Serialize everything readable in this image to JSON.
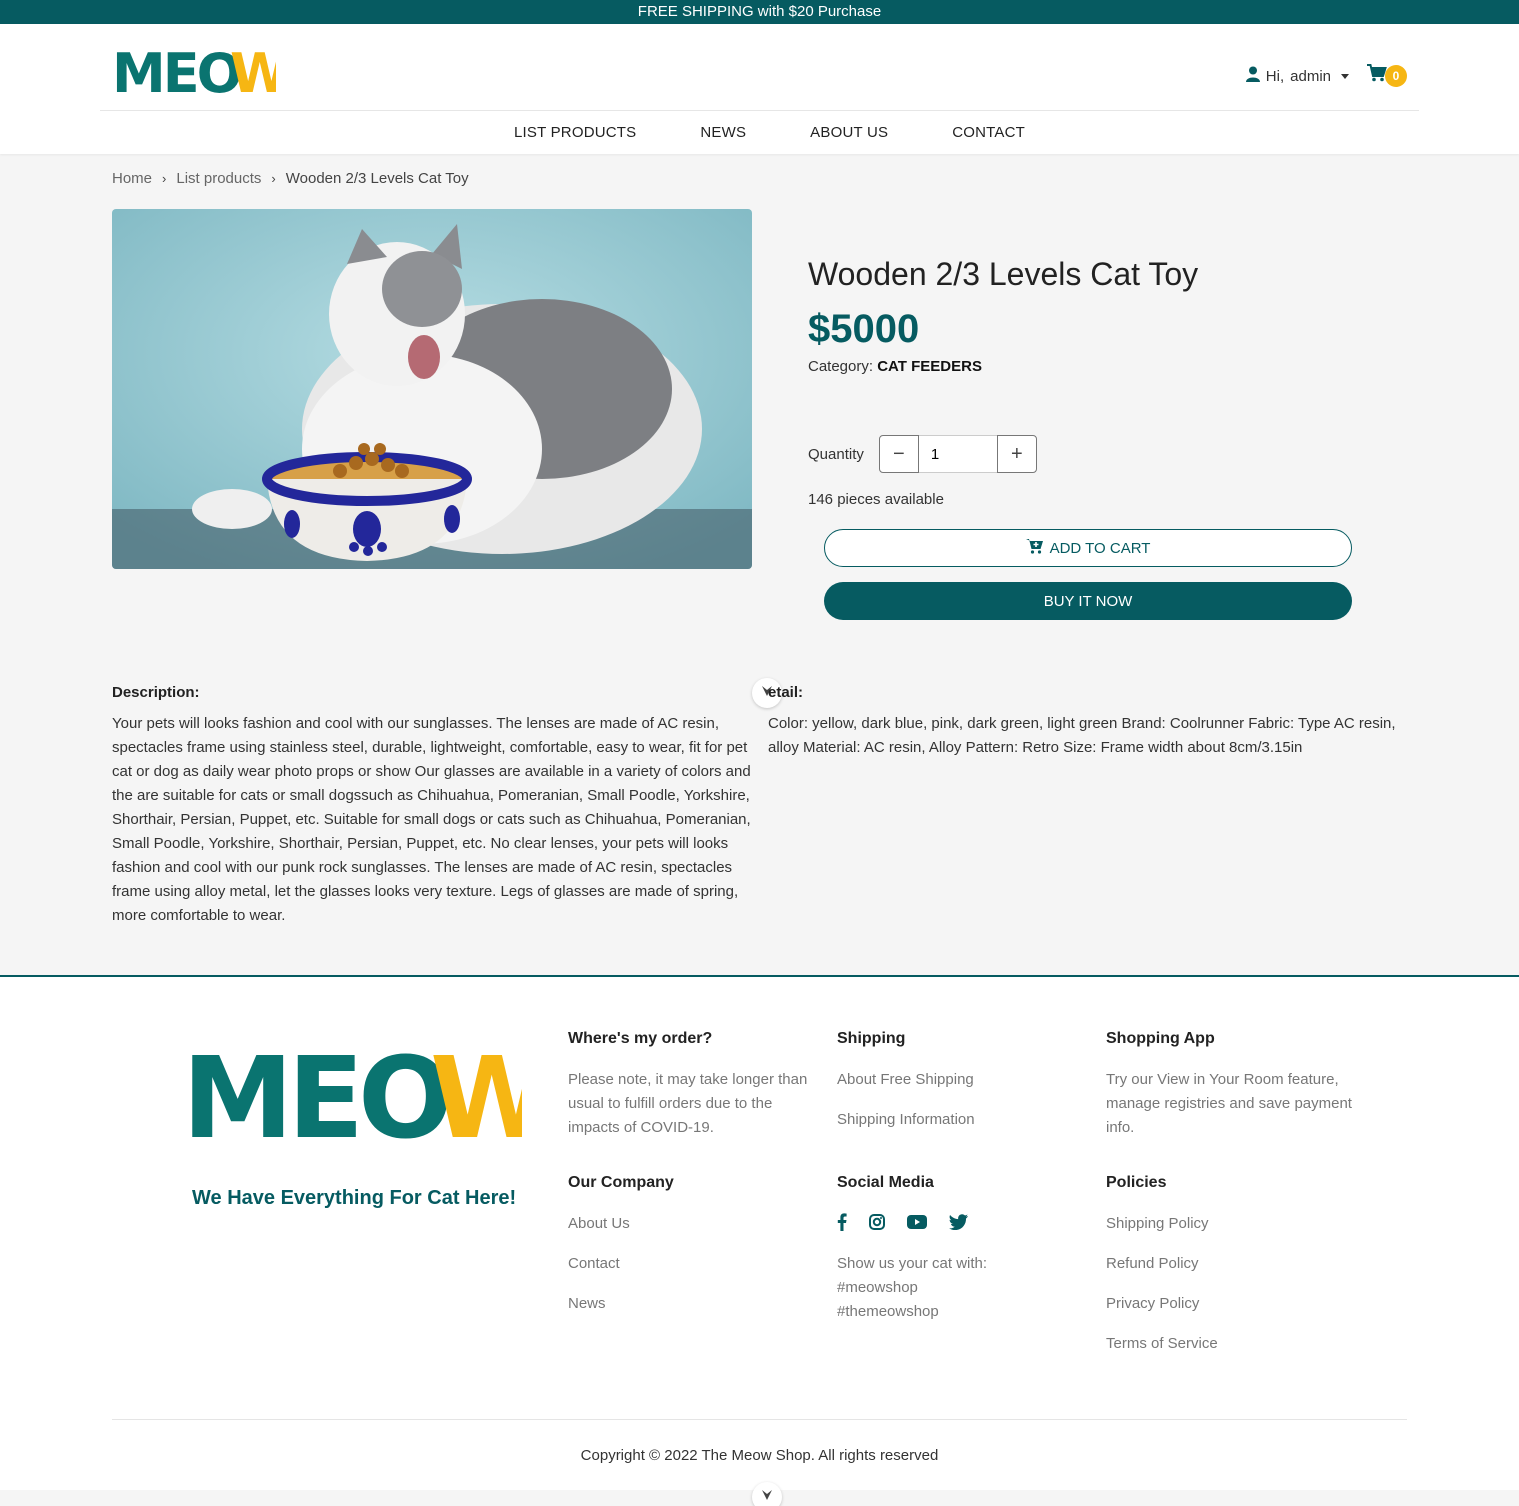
{
  "topbar": {
    "text": "FREE SHIPPING with $20 Purchase"
  },
  "header": {
    "logo_text": "MEOW",
    "user_greeting": "Hi,",
    "user_name": "admin",
    "cart_count": "0"
  },
  "nav": [
    "LIST PRODUCTS",
    "NEWS",
    "ABOUT US",
    "CONTACT"
  ],
  "breadcrumb": {
    "home": "Home",
    "list": "List products",
    "current": "Wooden 2/3 Levels Cat Toy"
  },
  "product": {
    "title": "Wooden 2/3 Levels Cat Toy",
    "price": "$5000",
    "category_label": "Category:",
    "category": "CAT FEEDERS",
    "quantity_label": "Quantity",
    "quantity": "1",
    "available": "146 pieces available",
    "add_to_cart": "ADD TO CART",
    "buy_now": "BUY IT NOW"
  },
  "description": {
    "heading": "Description:",
    "text": "Your pets will looks fashion and cool with our sunglasses. The lenses are made of AC resin, spectacles frame using stainless steel, durable, lightweight, comfortable, easy to wear, fit for pet cat or dog as daily wear photo props or show Our glasses are available in a variety of colors and the are suitable for cats or small dogssuch as Chihuahua, Pomeranian, Small Poodle, Yorkshire, Shorthair, Persian, Puppet, etc. Suitable for small dogs or cats such as Chihuahua, Pomeranian, Small Poodle, Yorkshire, Shorthair, Persian, Puppet, etc. No clear lenses, your pets will looks fashion and cool with our punk rock sunglasses. The lenses are made of AC resin, spectacles frame using alloy metal, let the glasses looks very texture. Legs of glasses are made of spring, more comfortable to wear."
  },
  "detail": {
    "heading": "etail:",
    "text": "Color: yellow, dark blue, pink, dark green, light green Brand: Coolrunner Fabric: Type AC resin, alloy Material: AC resin, Alloy Pattern: Retro Size: Frame width about 8cm/3.15in"
  },
  "footer": {
    "tagline": "We Have Everything For Cat Here!",
    "order": {
      "heading": "Where's my order?",
      "text": "Please note, it may take longer than usual to fulfill orders due to the impacts of COVID-19."
    },
    "shipping": {
      "heading": "Shipping",
      "links": [
        "About Free Shipping",
        "Shipping Information"
      ]
    },
    "app": {
      "heading": "Shopping App",
      "text": "Try our View in Your Room feature, manage registries and save payment info."
    },
    "company": {
      "heading": "Our Company",
      "links": [
        "About Us",
        "Contact",
        "News"
      ]
    },
    "social": {
      "heading": "Social Media",
      "line1": "Show us your cat with:",
      "line2": "#meowshop",
      "line3": "#themeowshop"
    },
    "policies": {
      "heading": "Policies",
      "links": [
        "Shipping Policy",
        "Refund Policy",
        "Privacy Policy",
        "Terms of Service"
      ]
    },
    "copyright": "Copyright © 2022 The Meow Shop. All rights reserved"
  },
  "colors": {
    "brand_teal": "#065b61",
    "logo_teal": "#0a7470",
    "logo_yellow": "#f6b613"
  }
}
